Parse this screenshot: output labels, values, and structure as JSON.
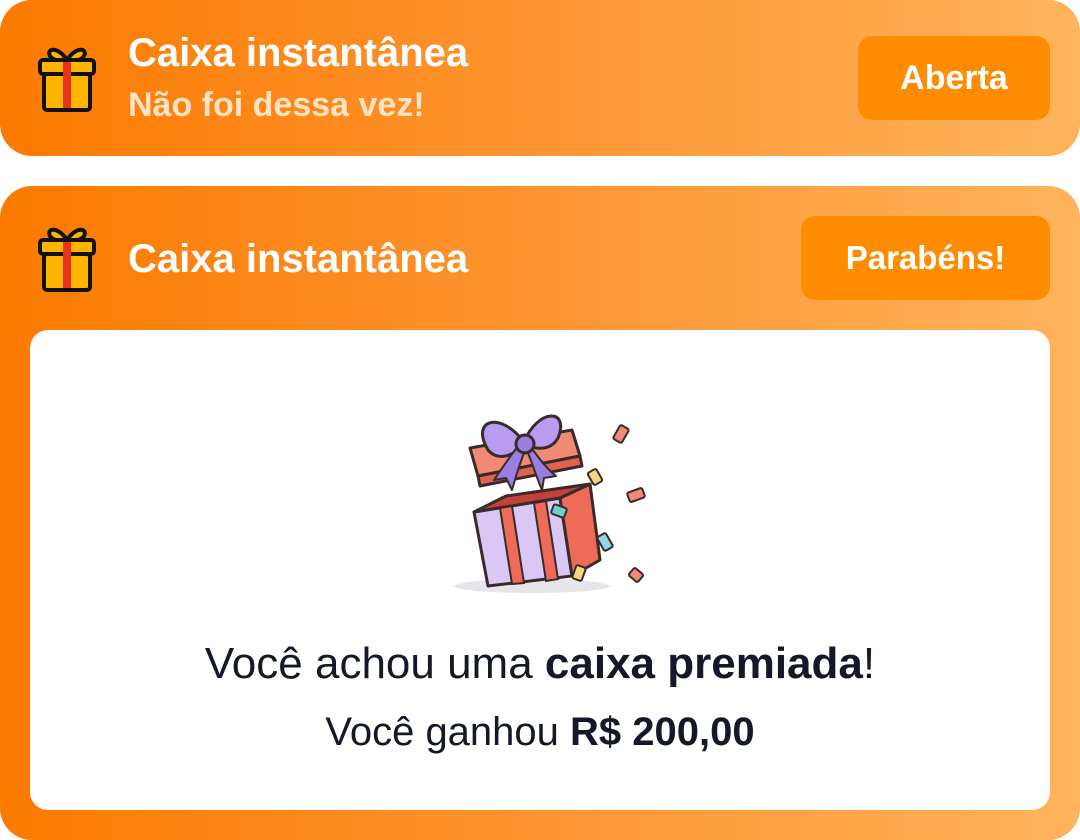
{
  "colors": {
    "card_gradient_start": "#fc7a00",
    "card_gradient_end": "#feb45c",
    "button_bg": "#ff8b00",
    "text_dark": "#151829",
    "subtitle": "#ffe3c4"
  },
  "cards": [
    {
      "icon": "gift-icon",
      "title": "Caixa instantânea",
      "subtitle": "Não foi dessa vez!",
      "status_label": "Aberta"
    },
    {
      "icon": "gift-icon",
      "title": "Caixa instantânea",
      "status_label": "Parabéns!",
      "result": {
        "illustration": "open-gift-box-with-confetti",
        "headline_prefix": "Você achou uma ",
        "headline_bold": "caixa premiada",
        "headline_suffix": "!",
        "prize_prefix": "Você ganhou ",
        "prize_amount": "R$ 200,00"
      }
    }
  ]
}
